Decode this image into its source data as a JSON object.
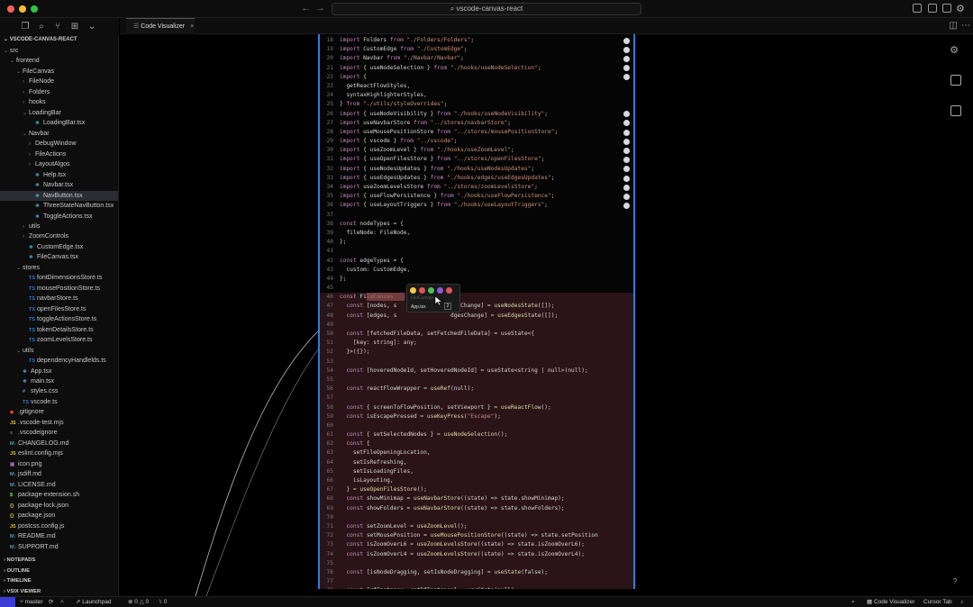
{
  "window": {
    "title": "vscode-canvas-react"
  },
  "colors": {
    "accent": "#2b7de0",
    "remote": "#3b3bd6",
    "highlight": "#2b1418"
  },
  "tab": {
    "label": "Code Visualizer",
    "close": "×"
  },
  "sidebar": {
    "root": "VSCODE-CANVAS-REACT",
    "tree": [
      {
        "label": "src",
        "depth": 0,
        "kind": "folder-open",
        "icon": ""
      },
      {
        "label": "frontend",
        "depth": 1,
        "kind": "folder-open",
        "icon": ""
      },
      {
        "label": "FileCanvas",
        "depth": 2,
        "kind": "folder-open",
        "icon": ""
      },
      {
        "label": "FileNode",
        "depth": 3,
        "kind": "folder",
        "icon": ""
      },
      {
        "label": "Folders",
        "depth": 3,
        "kind": "folder",
        "icon": ""
      },
      {
        "label": "hooks",
        "depth": 3,
        "kind": "folder",
        "icon": ""
      },
      {
        "label": "LoadingBar",
        "depth": 3,
        "kind": "folder-open",
        "icon": ""
      },
      {
        "label": "LoadingBar.tsx",
        "depth": 4,
        "kind": "file",
        "icon": "⚛"
      },
      {
        "label": "Navbar",
        "depth": 3,
        "kind": "folder-open",
        "icon": ""
      },
      {
        "label": "DebugWindow",
        "depth": 4,
        "kind": "folder",
        "icon": ""
      },
      {
        "label": "FileActions",
        "depth": 4,
        "kind": "folder",
        "icon": ""
      },
      {
        "label": "LayoutAlgos",
        "depth": 4,
        "kind": "folder",
        "icon": ""
      },
      {
        "label": "Help.tsx",
        "depth": 4,
        "kind": "file",
        "icon": "⚛"
      },
      {
        "label": "Navbar.tsx",
        "depth": 4,
        "kind": "file",
        "icon": "⚛"
      },
      {
        "label": "NavButton.tsx",
        "depth": 4,
        "kind": "file",
        "icon": "⚛",
        "selected": true
      },
      {
        "label": "ThreeStateNavButton.tsx",
        "depth": 4,
        "kind": "file",
        "icon": "⚛"
      },
      {
        "label": "ToggleActions.tsx",
        "depth": 4,
        "kind": "file",
        "icon": "⚛"
      },
      {
        "label": "utils",
        "depth": 3,
        "kind": "folder",
        "icon": ""
      },
      {
        "label": "ZoomControls",
        "depth": 3,
        "kind": "folder",
        "icon": ""
      },
      {
        "label": "CustomEdge.tsx",
        "depth": 3,
        "kind": "file",
        "icon": "⚛"
      },
      {
        "label": "FileCanvas.tsx",
        "depth": 3,
        "kind": "file",
        "icon": "⚛"
      },
      {
        "label": "stores",
        "depth": 2,
        "kind": "folder-open",
        "icon": ""
      },
      {
        "label": "fontDimensionsStore.ts",
        "depth": 3,
        "kind": "file",
        "icon": "TS"
      },
      {
        "label": "mousePositionStore.ts",
        "depth": 3,
        "kind": "file",
        "icon": "TS"
      },
      {
        "label": "navbarStore.ts",
        "depth": 3,
        "kind": "file",
        "icon": "TS"
      },
      {
        "label": "openFilesStore.ts",
        "depth": 3,
        "kind": "file",
        "icon": "TS"
      },
      {
        "label": "toggleActionsStore.ts",
        "depth": 3,
        "kind": "file",
        "icon": "TS"
      },
      {
        "label": "tokenDetailsStore.ts",
        "depth": 3,
        "kind": "file",
        "icon": "TS"
      },
      {
        "label": "zoomLevelsStore.ts",
        "depth": 3,
        "kind": "file",
        "icon": "TS"
      },
      {
        "label": "utils",
        "depth": 2,
        "kind": "folder-open",
        "icon": ""
      },
      {
        "label": "dependencyHandlelds.ts",
        "depth": 3,
        "kind": "file",
        "icon": "TS"
      },
      {
        "label": "App.tsx",
        "depth": 2,
        "kind": "file",
        "icon": "⚛"
      },
      {
        "label": "main.tsx",
        "depth": 2,
        "kind": "file",
        "icon": "⚛"
      },
      {
        "label": "styles.css",
        "depth": 2,
        "kind": "file",
        "icon": "#"
      },
      {
        "label": "vscode.ts",
        "depth": 2,
        "kind": "file",
        "icon": "TS"
      },
      {
        "label": ".gitignore",
        "depth": 0,
        "kind": "file",
        "icon": "◆"
      },
      {
        "label": ".vscode-test.mjs",
        "depth": 0,
        "kind": "file",
        "icon": "JS"
      },
      {
        "label": ".vscodeignore",
        "depth": 0,
        "kind": "file",
        "icon": "≡"
      },
      {
        "label": "CHANGELOG.md",
        "depth": 0,
        "kind": "file",
        "icon": "M↓"
      },
      {
        "label": "eslint.config.mjs",
        "depth": 0,
        "kind": "file",
        "icon": "JS"
      },
      {
        "label": "icon.png",
        "depth": 0,
        "kind": "file",
        "icon": "▣"
      },
      {
        "label": "jsdiff.md",
        "depth": 0,
        "kind": "file",
        "icon": "M↓"
      },
      {
        "label": "LICENSE.md",
        "depth": 0,
        "kind": "file",
        "icon": "M↓"
      },
      {
        "label": "package-extension.sh",
        "depth": 0,
        "kind": "file",
        "icon": "$"
      },
      {
        "label": "package-lock.json",
        "depth": 0,
        "kind": "file",
        "icon": "{}"
      },
      {
        "label": "package.json",
        "depth": 0,
        "kind": "file",
        "icon": "{}"
      },
      {
        "label": "postcss.config.js",
        "depth": 0,
        "kind": "file",
        "icon": "JS"
      },
      {
        "label": "README.md",
        "depth": 0,
        "kind": "file",
        "icon": "M↓"
      },
      {
        "label": "SUPPORT.md",
        "depth": 0,
        "kind": "file",
        "icon": "M↓"
      }
    ],
    "sections": [
      "NOTEPADS",
      "OUTLINE",
      "TIMELINE",
      "VSIX VIEWER"
    ]
  },
  "code": [
    {
      "n": 18,
      "text": "import Folders from \"./Folders/Folders\";"
    },
    {
      "n": 19,
      "text": "import CustomEdge from \"./CustomEdge\";"
    },
    {
      "n": 20,
      "text": "import Navbar from \"./Navbar/Navbar\";"
    },
    {
      "n": 21,
      "text": "import { useNodeSelection } from \"./hooks/useNodeSelection\";"
    },
    {
      "n": 22,
      "text": "import {"
    },
    {
      "n": 23,
      "text": "  getReactFlowStyles,"
    },
    {
      "n": 24,
      "text": "  syntaxHighlighterStyles,"
    },
    {
      "n": 25,
      "text": "} from \"./utils/styleOverrides\";"
    },
    {
      "n": 26,
      "text": "import { useNodeVisibility } from \"./hooks/useNodeVisibility\";"
    },
    {
      "n": 27,
      "text": "import useNavbarStore from \"../stores/navbarStore\";"
    },
    {
      "n": 28,
      "text": "import useMousePositionStore from \"../stores/mousePositionStore\";"
    },
    {
      "n": 29,
      "text": "import { vscode } from \"../vscode\";"
    },
    {
      "n": 30,
      "text": "import { useZoomLevel } from \"./hooks/useZoomLevel\";"
    },
    {
      "n": 31,
      "text": "import { useOpenFilesStore } from \"../stores/openFilesStore\";"
    },
    {
      "n": 32,
      "text": "import { useNodesUpdates } from \"./hooks/useNodesUpdates\";"
    },
    {
      "n": 33,
      "text": "import { useEdgesUpdates } from \"./hooks/edges/useEdgesUpdates\";"
    },
    {
      "n": 34,
      "text": "import useZoomLevelsStore from \"../stores/zoomLevelsStore\";"
    },
    {
      "n": 35,
      "text": "import { useFlowPersistence } from \"./hooks/useFlowPersistence\";"
    },
    {
      "n": 36,
      "text": "import { useLayoutTriggers } from \"./hooks/useLayoutTriggers\";"
    },
    {
      "n": 37,
      "text": ""
    },
    {
      "n": 38,
      "text": "const nodeTypes = {"
    },
    {
      "n": 39,
      "text": "  fileNode: FileNode,"
    },
    {
      "n": 40,
      "text": "};"
    },
    {
      "n": 41,
      "text": ""
    },
    {
      "n": 42,
      "text": "const edgeTypes = {"
    },
    {
      "n": 43,
      "text": "  custom: CustomEdge,"
    },
    {
      "n": 44,
      "text": "};"
    },
    {
      "n": 45,
      "text": ""
    },
    {
      "n": 46,
      "text": "const FileCanvas",
      "hl": true
    },
    {
      "n": 47,
      "text": "  const [nodes, s                desChange] = useNodesState([]);",
      "hl": true
    },
    {
      "n": 48,
      "text": "  const [edges, s                dgesChange] = useEdgesState([]);",
      "hl": true
    },
    {
      "n": 49,
      "text": "",
      "hl": true
    },
    {
      "n": 50,
      "text": "  const [fetchedFileData, setFetchedFileData] = useState<{",
      "hl": true
    },
    {
      "n": 51,
      "text": "    [key: string]: any;",
      "hl": true
    },
    {
      "n": 52,
      "text": "  }>({});",
      "hl": true
    },
    {
      "n": 53,
      "text": "",
      "hl": true
    },
    {
      "n": 54,
      "text": "  const [hoveredNodeId, setHoveredNodeId] = useState<string | null>(null);",
      "hl": true
    },
    {
      "n": 55,
      "text": "",
      "hl": true
    },
    {
      "n": 56,
      "text": "  const reactFlowWrapper = useRef(null);",
      "hl": true
    },
    {
      "n": 57,
      "text": "",
      "hl": true
    },
    {
      "n": 58,
      "text": "  const { screenToFlowPosition, setViewport } = useReactFlow();",
      "hl": true
    },
    {
      "n": 59,
      "text": "  const isEscapePressed = useKeyPress(\"Escape\");",
      "hl": true
    },
    {
      "n": 60,
      "text": "",
      "hl": true
    },
    {
      "n": 61,
      "text": "  const { setSelectedNodes } = useNodeSelection();",
      "hl": true
    },
    {
      "n": 62,
      "text": "  const {",
      "hl": true
    },
    {
      "n": 63,
      "text": "    setFileOpeningLocation,",
      "hl": true
    },
    {
      "n": 64,
      "text": "    setIsRefreshing,",
      "hl": true
    },
    {
      "n": 65,
      "text": "    setIsLoadingFiles,",
      "hl": true
    },
    {
      "n": 66,
      "text": "    isLayouting,",
      "hl": true
    },
    {
      "n": 67,
      "text": "  } = useOpenFilesStore();",
      "hl": true
    },
    {
      "n": 68,
      "text": "  const showMinimap = useNavbarStore((state) => state.showMinimap);",
      "hl": true
    },
    {
      "n": 69,
      "text": "  const showFolders = useNavbarStore((state) => state.showFolders);",
      "hl": true
    },
    {
      "n": 70,
      "text": "",
      "hl": true
    },
    {
      "n": 71,
      "text": "  const setZoomLevel = useZoomLevel();",
      "hl": true
    },
    {
      "n": 72,
      "text": "  const setMousePosition = useMousePositionStore((state) => state.setPosition",
      "hl": true
    },
    {
      "n": 73,
      "text": "  const isZoomOverL6 = useZoomLevelsStore((state) => state.isZoomOverL6);",
      "hl": true
    },
    {
      "n": 74,
      "text": "  const isZoomOverL4 = useZoomLevelsStore((state) => state.isZoomOverL4);",
      "hl": true
    },
    {
      "n": 75,
      "text": "",
      "hl": true
    },
    {
      "n": 76,
      "text": "  const [isNodeDragging, setIsNodeDragging] = useState(false);",
      "hl": true
    },
    {
      "n": 77,
      "text": "",
      "hl": true
    },
    {
      "n": 78,
      "text": "  const [rfInstance, setRfInstance] = useState(null);",
      "hl": true
    }
  ],
  "dep_lines": [
    18,
    19,
    20,
    21,
    22,
    26,
    27,
    28,
    29,
    30,
    31,
    32,
    33,
    34,
    35,
    36
  ],
  "tooltip": {
    "label": "App.tsx",
    "badge": "2",
    "faded": "FileCanvas"
  },
  "statusbar": {
    "branch": "master",
    "launchpad": "Launchpad",
    "errors": "0",
    "warnings": "0",
    "ports": "0",
    "code_visualizer": "Code Visualizer",
    "cursor_tab": "Cursor Tab"
  }
}
